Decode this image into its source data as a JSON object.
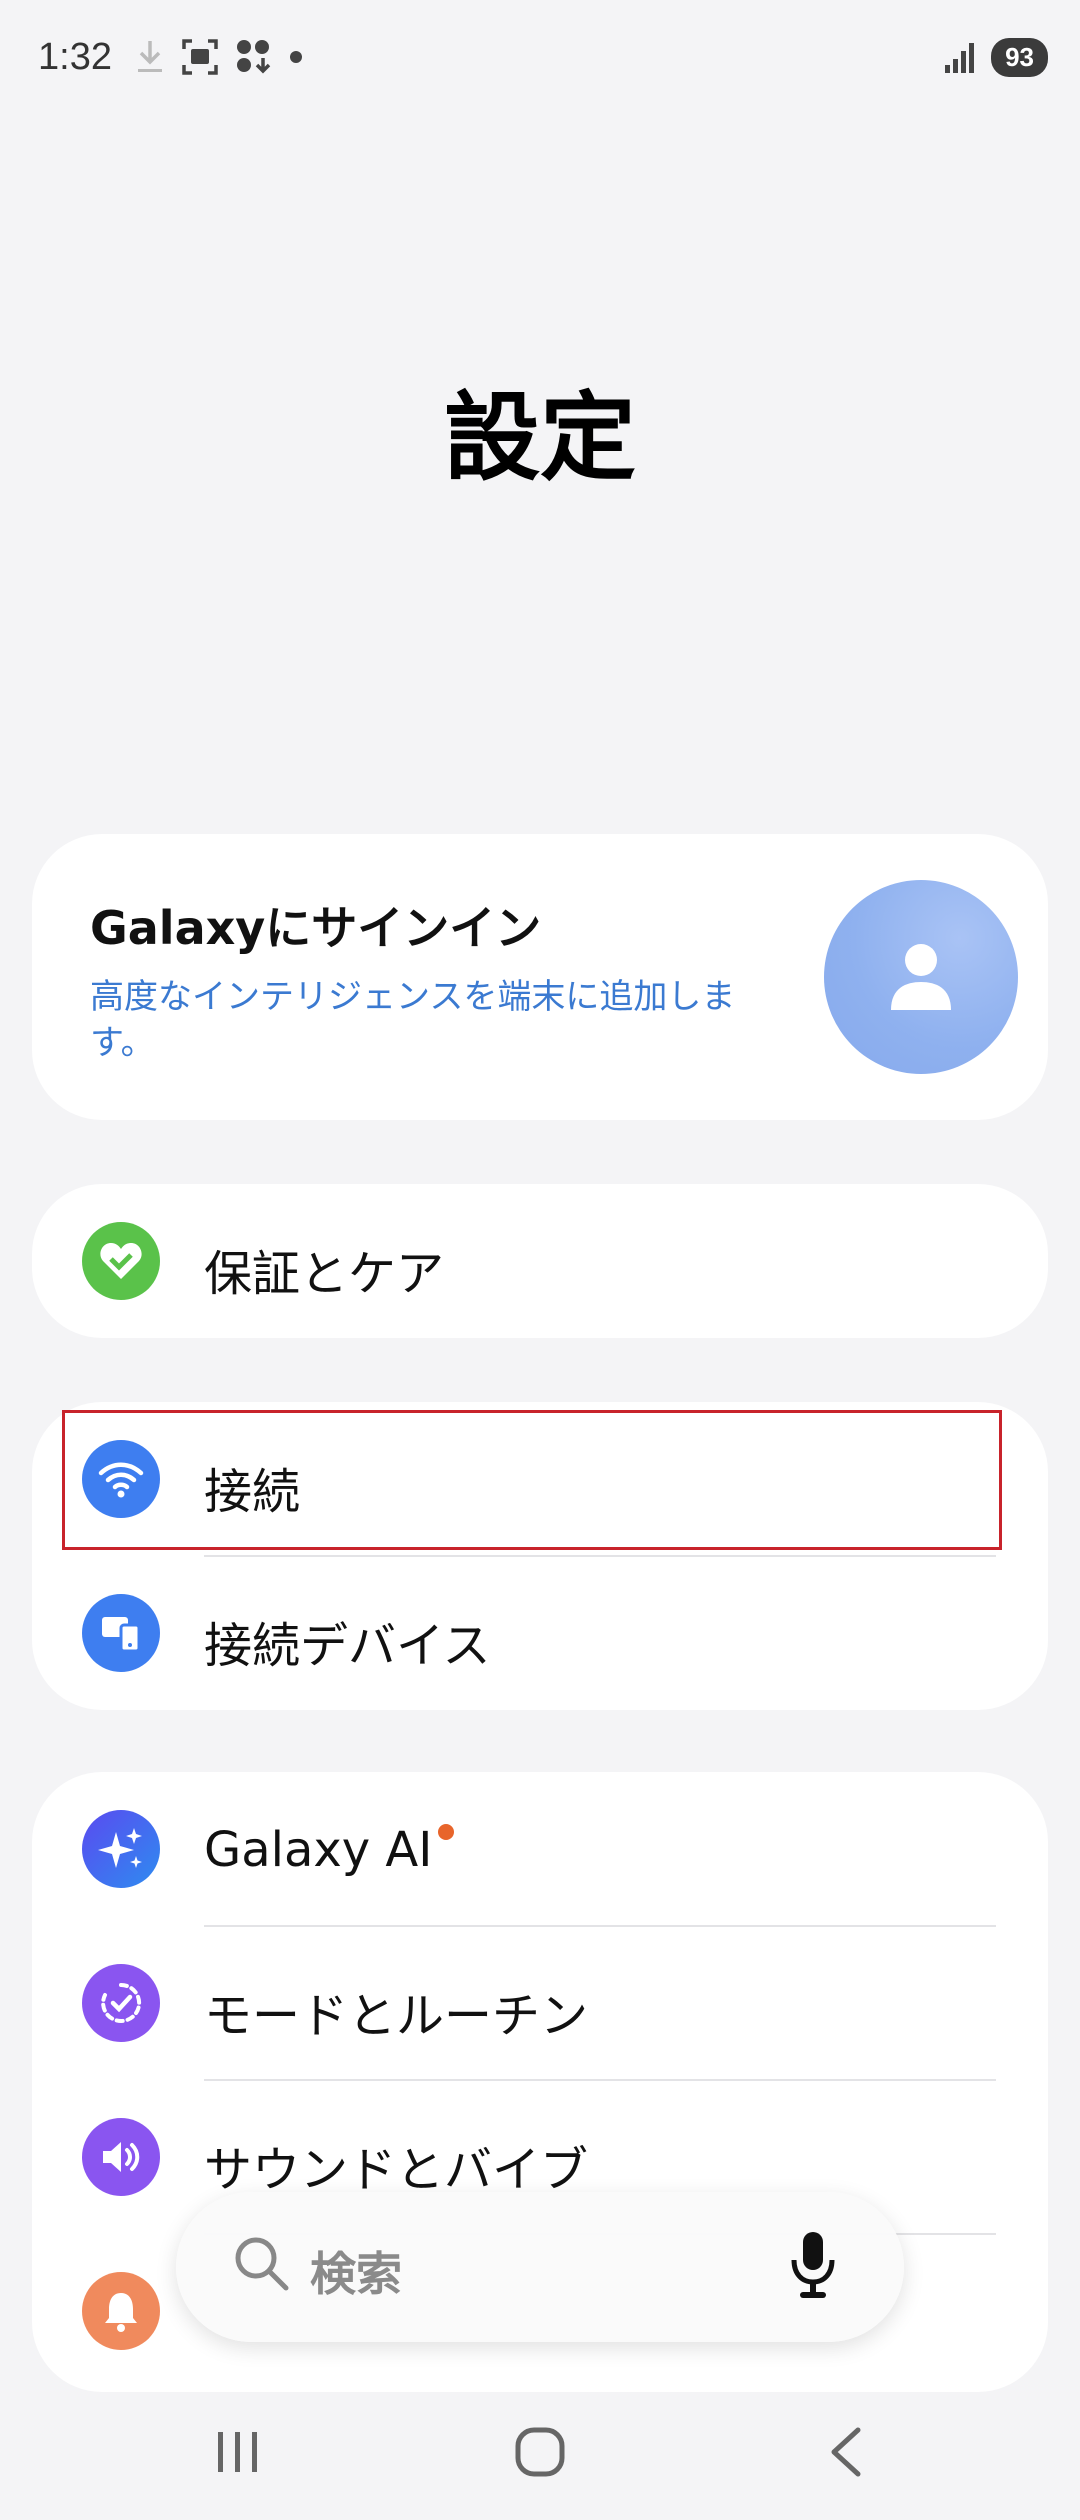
{
  "status": {
    "time": "1:32",
    "battery": "93"
  },
  "page": {
    "title": "設定"
  },
  "signin": {
    "title": "Galaxyにサインイン",
    "subtitle": "高度なインテリジェンスを端末に追加します。"
  },
  "groups": [
    {
      "items": [
        {
          "label": "保証とケア",
          "icon": "heart-icon",
          "color": "#5ac24a"
        }
      ]
    },
    {
      "items": [
        {
          "label": "接続",
          "icon": "wifi-icon",
          "color": "#3e7ef0"
        },
        {
          "label": "接続デバイス",
          "icon": "connected-devices-icon",
          "color": "#3e7ef0"
        }
      ]
    },
    {
      "items": [
        {
          "label": "Galaxy AI",
          "icon": "sparkle-icon",
          "color": "#3b6ff0"
        },
        {
          "label": "モードとルーチン",
          "icon": "routine-icon",
          "color": "#8a55f0"
        },
        {
          "label": "サウンドとバイブ",
          "icon": "speaker-icon",
          "color": "#8a55f0"
        },
        {
          "label": "",
          "icon": "bell-icon",
          "color": "#f08a5d"
        }
      ]
    }
  ],
  "search": {
    "label": "検索"
  },
  "colors": {
    "accent": "#3b7ad1",
    "highlight_box": "#c8232b",
    "ai_badge": "#e8652b"
  }
}
